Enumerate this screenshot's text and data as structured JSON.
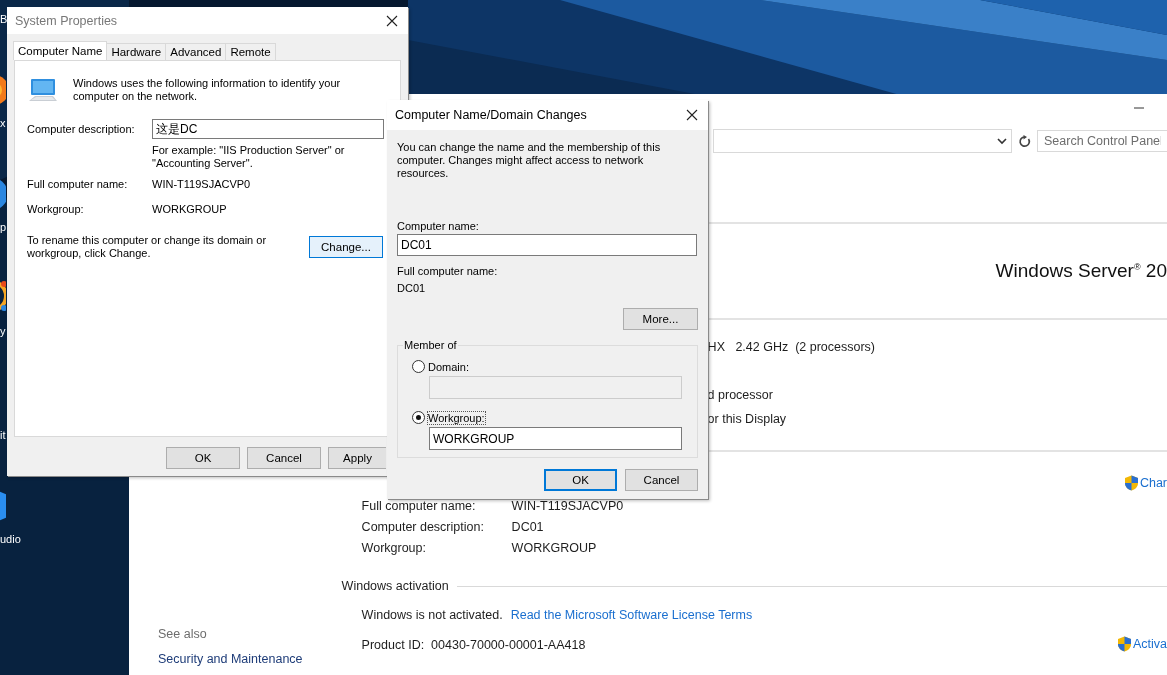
{
  "desktop": {
    "icon_labels": [
      "B",
      "x",
      "p",
      "y",
      "it",
      "udio"
    ]
  },
  "control_panel": {
    "search": {
      "placeholder": "Search Control Panel"
    },
    "edition": "Windows Server$^{®}$ 20",
    "system_rows": [
      "HX   2.42 GHz  (2 processors)",
      "d processor",
      "or this Display"
    ],
    "change_settings_link": "Char",
    "computer_rows": [
      {
        "label": "Full computer name:",
        "value": "WIN-T119SJACVP0"
      },
      {
        "label": "Computer description:",
        "value": "DC01"
      },
      {
        "label": "Workgroup:",
        "value": "WORKGROUP"
      }
    ],
    "activation": {
      "heading": "Windows activation",
      "status": "Windows is not activated.",
      "link": "Read the Microsoft Software License Terms",
      "product_id": "Product ID:  00430-70000-00001-AA418",
      "activate_link": "Activa"
    },
    "see_also": {
      "heading": "See also",
      "links": [
        "Security and Maintenance"
      ]
    }
  },
  "system_properties": {
    "title": "System Properties",
    "tabs": [
      {
        "label": "Computer Name",
        "selected": true
      },
      {
        "label": "Hardware",
        "selected": false
      },
      {
        "label": "Advanced",
        "selected": false
      },
      {
        "label": "Remote",
        "selected": false
      }
    ],
    "intro": "Windows uses the following information to identify your computer on the network.",
    "rows": [
      {
        "kind": "field",
        "label": "Computer description:",
        "value": "这是DC"
      },
      {
        "kind": "note",
        "text": "For example: \"IIS Production Server\" or \"Accounting Server\"."
      },
      {
        "kind": "text",
        "label": "Full computer name:",
        "value": "WIN-T119SJACVP0"
      },
      {
        "kind": "text",
        "label": "Workgroup:",
        "value": "WORKGROUP"
      }
    ],
    "rename_text": "To rename this computer or change its domain or workgroup, click Change.",
    "change_button": "Change...",
    "buttons": [
      "OK",
      "Cancel",
      "Apply"
    ]
  },
  "name_dialog": {
    "title": "Computer Name/Domain Changes",
    "intro": "You can change the name and the membership of this computer. Changes might affect access to network resources.",
    "computer_name": {
      "label": "Computer name:",
      "value": "DC01"
    },
    "full_name": {
      "label": "Full computer name:",
      "value": "DC01"
    },
    "more_button": "More...",
    "member_of": {
      "legend": "Member of",
      "options": [
        {
          "label": "Domain:",
          "selected": false
        },
        {
          "label": "Workgroup:",
          "selected": true,
          "value": "WORKGROUP"
        }
      ]
    },
    "buttons": [
      {
        "label": "OK",
        "default": true
      },
      {
        "label": "Cancel",
        "default": false
      }
    ]
  }
}
